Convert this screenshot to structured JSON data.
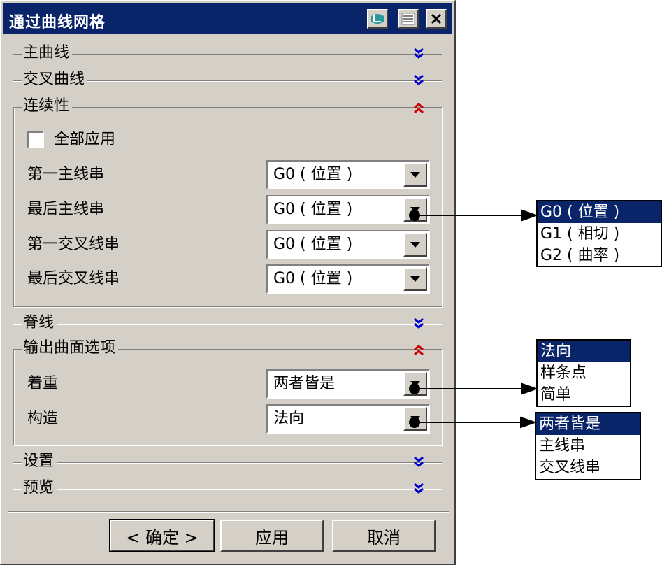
{
  "dialog": {
    "title": "通过曲线网格",
    "title_buttons": [
      "restore-icon",
      "list-icon",
      "close-icon"
    ]
  },
  "sections": {
    "main_curves": {
      "label": "主曲线",
      "state": "collapsed"
    },
    "cross_curves": {
      "label": "交叉曲线",
      "state": "collapsed"
    },
    "continuity": {
      "label": "连续性",
      "state": "expanded",
      "apply_all_label": "全部应用",
      "apply_all_checked": false,
      "rows": [
        {
          "label": "第一主线串",
          "value": "G0 ( 位置 )"
        },
        {
          "label": "最后主线串",
          "value": "G0 ( 位置 )"
        },
        {
          "label": "第一交叉线串",
          "value": "G0 ( 位置 )"
        },
        {
          "label": "最后交叉线串",
          "value": "G0 ( 位置 )"
        }
      ]
    },
    "spine": {
      "label": "脊线",
      "state": "collapsed"
    },
    "output_options": {
      "label": "输出曲面选项",
      "state": "expanded",
      "rows": [
        {
          "label": "着重",
          "value": "两者皆是"
        },
        {
          "label": "构造",
          "value": "法向"
        }
      ]
    },
    "settings": {
      "label": "设置",
      "state": "collapsed"
    },
    "preview": {
      "label": "预览",
      "state": "collapsed"
    }
  },
  "buttons": {
    "ok": "< 确定 >",
    "apply": "应用",
    "cancel": "取消"
  },
  "popups": {
    "continuity_options": [
      "G0 ( 位置 )",
      "G1 ( 相切 )",
      "G2 ( 曲率 )"
    ],
    "continuity_selected": 0,
    "construction_options": [
      "法向",
      "样条点",
      "简单"
    ],
    "construction_selected": 0,
    "emphasis_options": [
      "两者皆是",
      "主线串",
      "交叉线串"
    ],
    "emphasis_selected": 0
  },
  "colors": {
    "titlebar": "#0a246a",
    "face": "#d4d0c8",
    "chevron_collapsed": "#0000cc",
    "chevron_expanded": "#cc0000"
  }
}
